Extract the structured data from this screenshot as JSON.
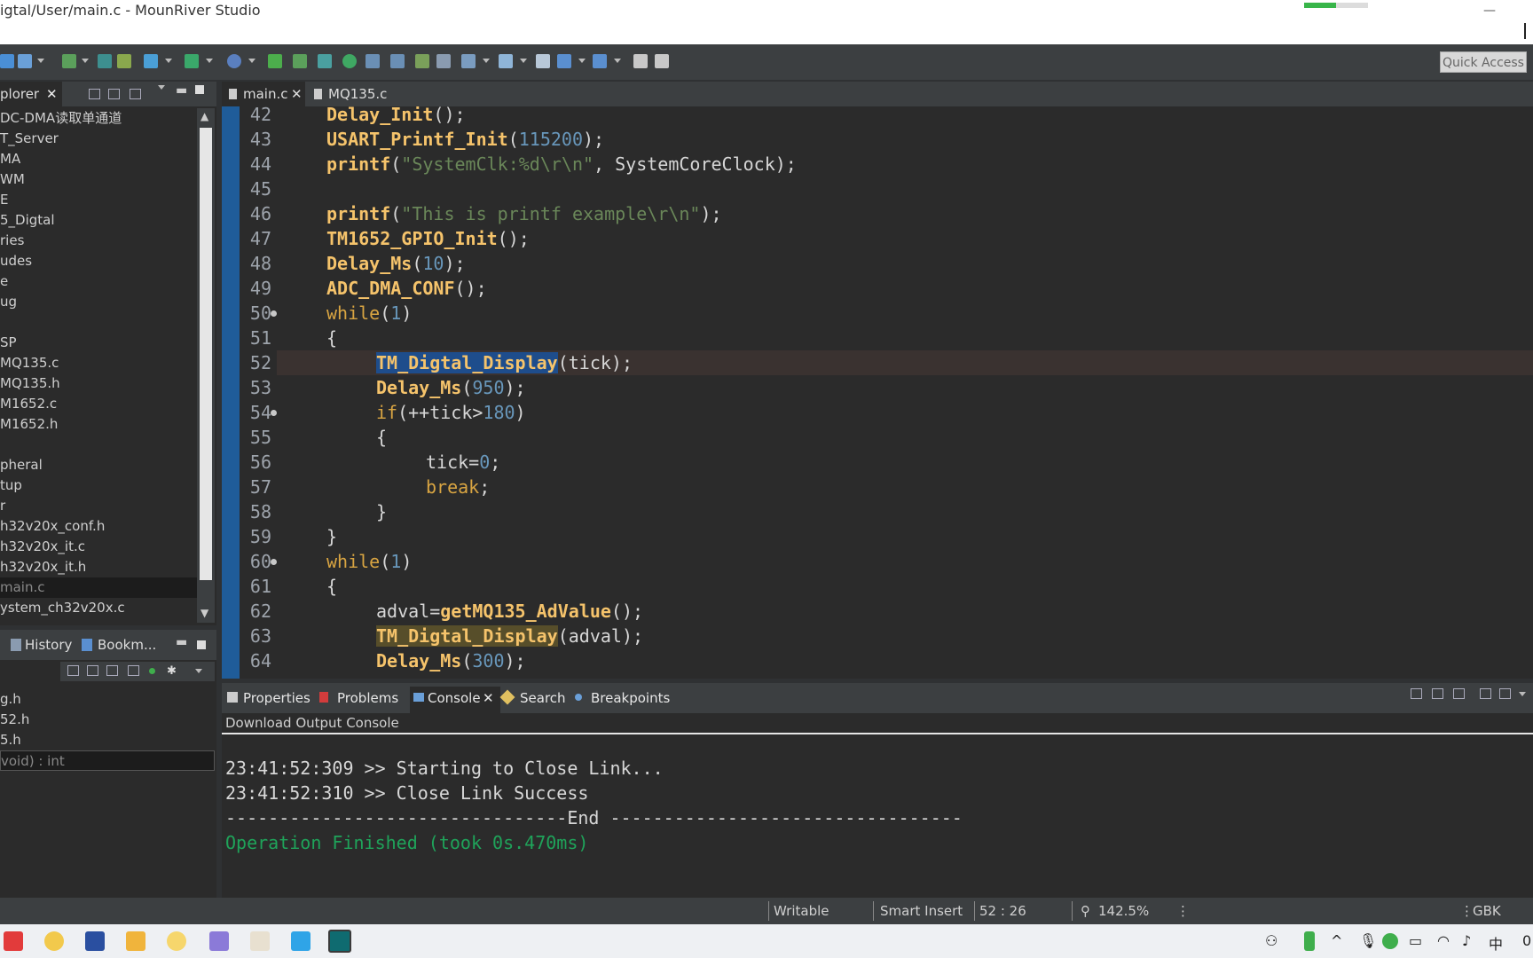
{
  "window": {
    "title": "igtal/User/main.c - MounRiver Studio",
    "progress": 0.5,
    "minimize_glyph": "—"
  },
  "toolbar": {
    "quick_access": "Quick Access"
  },
  "explorer": {
    "tab_label": "plorer",
    "close_glyph": "✕",
    "items": [
      "DC-DMA读取单通道",
      "T_Server",
      "MA",
      "WM",
      "E",
      "5_Digtal",
      "ries",
      "udes",
      "e",
      "ug",
      "",
      "SP",
      "MQ135.c",
      "MQ135.h",
      "M1652.c",
      "M1652.h",
      "",
      "pheral",
      "tup",
      "r",
      "h32v20x_conf.h",
      "h32v20x_it.c",
      "h32v20x_it.h",
      "main.c",
      "ystem_ch32v20x.c"
    ],
    "selected_index": 23,
    "scroll_up": "▲",
    "scroll_down": "▼"
  },
  "history_panel": {
    "tabs": [
      "History",
      "Bookm..."
    ],
    "items": [
      "g.h",
      "52.h",
      "5.h",
      "void) : int"
    ],
    "selected_index": 3
  },
  "editor": {
    "tabs": [
      {
        "label": "main.c",
        "close": "✕",
        "active": true
      },
      {
        "label": "MQ135.c",
        "active": false
      }
    ],
    "lines": [
      {
        "n": "42",
        "code": "Delay_Init();",
        "indent": 0
      },
      {
        "n": "43",
        "code": "USART_Printf_Init(115200);",
        "indent": 0
      },
      {
        "n": "44",
        "code": "printf(\"SystemClk:%d\\r\\n\", SystemCoreClock);",
        "indent": 0
      },
      {
        "n": "45",
        "code": "",
        "indent": 0
      },
      {
        "n": "46",
        "code": "printf(\"This is printf example\\r\\n\");",
        "indent": 0
      },
      {
        "n": "47",
        "code": "TM1652_GPIO_Init();",
        "indent": 0
      },
      {
        "n": "48",
        "code": "Delay_Ms(10);",
        "indent": 0
      },
      {
        "n": "49",
        "code": "ADC_DMA_CONF();",
        "indent": 0
      },
      {
        "n": "50",
        "code": "while(1)",
        "indent": 0,
        "marker": true
      },
      {
        "n": "51",
        "code": "{",
        "indent": 0
      },
      {
        "n": "52",
        "code": "TM_Digtal_Display(tick);",
        "indent": 1,
        "current": true
      },
      {
        "n": "53",
        "code": "Delay_Ms(950);",
        "indent": 1
      },
      {
        "n": "54",
        "code": "if(++tick>180)",
        "indent": 1,
        "marker": true
      },
      {
        "n": "55",
        "code": "{",
        "indent": 1
      },
      {
        "n": "56",
        "code": "tick=0;",
        "indent": 2
      },
      {
        "n": "57",
        "code": "break;",
        "indent": 2
      },
      {
        "n": "58",
        "code": "}",
        "indent": 1
      },
      {
        "n": "59",
        "code": "}",
        "indent": 0
      },
      {
        "n": "60",
        "code": "while(1)",
        "indent": 0,
        "marker": true
      },
      {
        "n": "61",
        "code": "{",
        "indent": 0
      },
      {
        "n": "62",
        "code": "adval=getMQ135_AdValue();",
        "indent": 1
      },
      {
        "n": "63",
        "code": "TM_Digtal_Display(adval);",
        "indent": 1
      },
      {
        "n": "64",
        "code": "Delay_Ms(300);",
        "indent": 1
      }
    ]
  },
  "console": {
    "tabs": [
      {
        "label": "Properties"
      },
      {
        "label": "Problems"
      },
      {
        "label": "Console",
        "close": "✕",
        "active": true
      },
      {
        "label": "Search"
      },
      {
        "label": "Breakpoints"
      }
    ],
    "title": "Download Output Console",
    "lines": [
      "23:41:52:309 >> Starting to Close Link...",
      "23:41:52:310 >> Close Link Success",
      "--------------------------------End ---------------------------------",
      "Operation Finished (took 0s.470ms)"
    ]
  },
  "status": {
    "writable": "Writable",
    "insert_mode": "Smart Insert",
    "position": "52 : 26",
    "zoom": "142.5%",
    "encoding": "GBK"
  },
  "taskbar": {
    "time_fragment": "0:"
  },
  "colors": {
    "accent_blue": "#1f5c99",
    "function": "#f5c36b",
    "keyword": "#d9a542",
    "number": "#6897bb",
    "string": "#6a8759",
    "success_green": "#1fa35a"
  }
}
